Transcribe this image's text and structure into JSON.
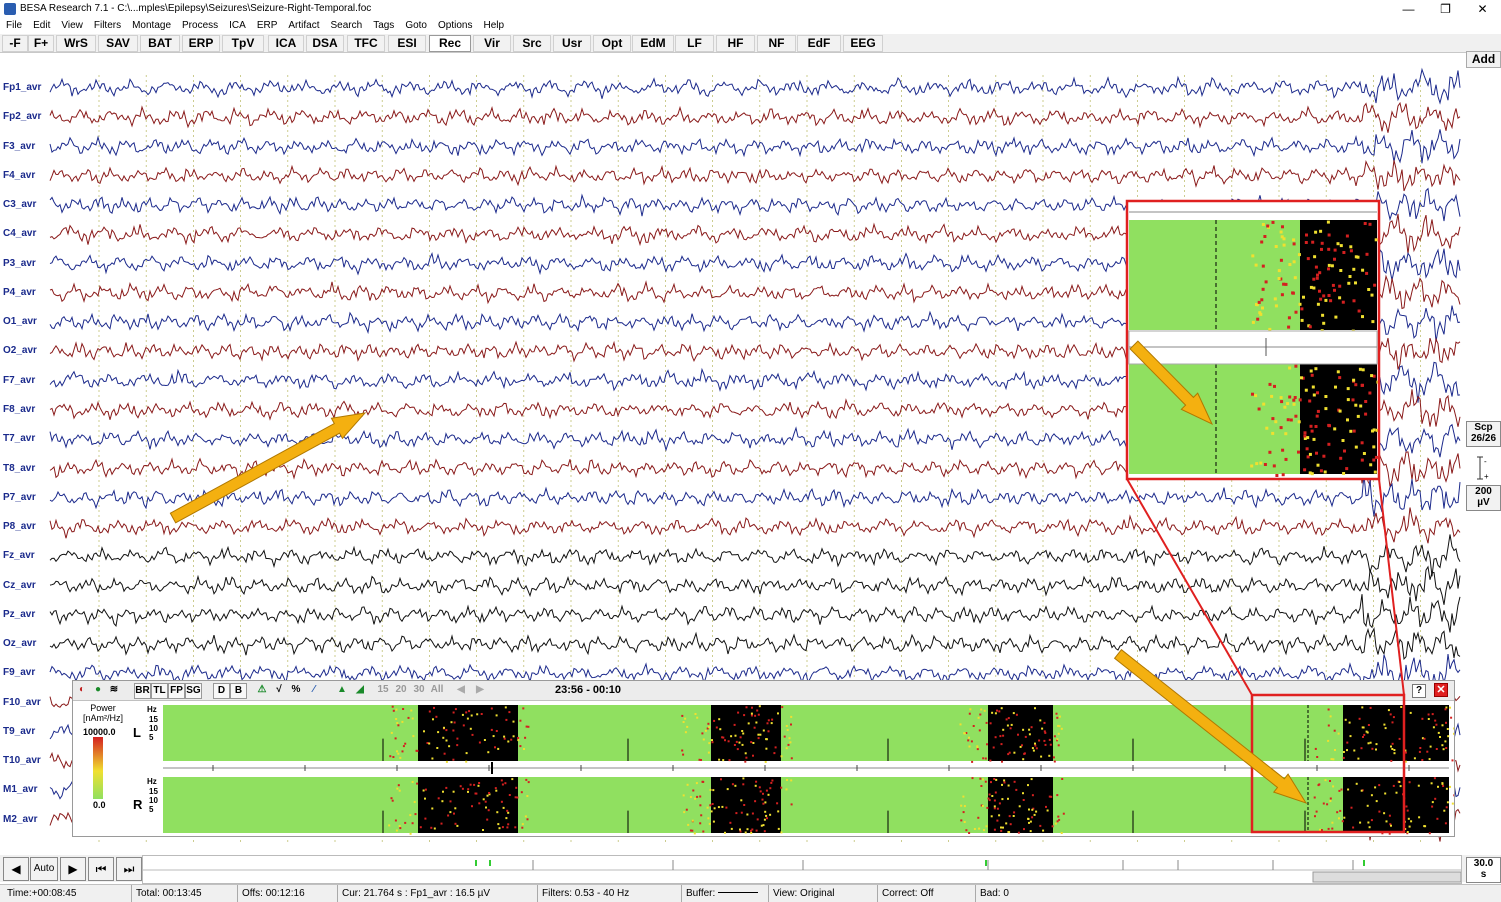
{
  "window": {
    "title": "BESA Research 7.1 - C:\\...mples\\Epilepsy\\Seizures\\Seizure-Right-Temporal.foc",
    "minimize": "—",
    "maximize": "❐",
    "close": "✕"
  },
  "menu": [
    "File",
    "Edit",
    "View",
    "Filters",
    "Montage",
    "Process",
    "ICA",
    "ERP",
    "Artifact",
    "Search",
    "Tags",
    "Goto",
    "Options",
    "Help"
  ],
  "toolbar": {
    "buttons": [
      "-F",
      "F+",
      "WrS",
      "SAV",
      "BAT",
      "ERP",
      "TpV",
      "ICA",
      "DSA",
      "TFC",
      "ESI",
      "Rec",
      "Vir",
      "Src",
      "Usr",
      "Opt",
      "EdM",
      "LF",
      "HF",
      "NF",
      "EdF",
      "EEG"
    ],
    "active": "Rec",
    "add": "Add"
  },
  "channels": [
    {
      "name": "Fp1_avr",
      "color": "#1c2a8c"
    },
    {
      "name": "Fp2_avr",
      "color": "#8a1a1a"
    },
    {
      "name": "F3_avr",
      "color": "#1c2a8c"
    },
    {
      "name": "F4_avr",
      "color": "#8a1a1a"
    },
    {
      "name": "C3_avr",
      "color": "#1c2a8c"
    },
    {
      "name": "C4_avr",
      "color": "#8a1a1a"
    },
    {
      "name": "P3_avr",
      "color": "#1c2a8c"
    },
    {
      "name": "P4_avr",
      "color": "#8a1a1a"
    },
    {
      "name": "O1_avr",
      "color": "#1c2a8c"
    },
    {
      "name": "O2_avr",
      "color": "#8a1a1a"
    },
    {
      "name": "F7_avr",
      "color": "#1c2a8c"
    },
    {
      "name": "F8_avr",
      "color": "#8a1a1a"
    },
    {
      "name": "T7_avr",
      "color": "#1c2a8c"
    },
    {
      "name": "T8_avr",
      "color": "#8a1a1a"
    },
    {
      "name": "P7_avr",
      "color": "#1c2a8c"
    },
    {
      "name": "P8_avr",
      "color": "#8a1a1a"
    },
    {
      "name": "Fz_avr",
      "color": "#111111"
    },
    {
      "name": "Cz_avr",
      "color": "#111111"
    },
    {
      "name": "Pz_avr",
      "color": "#111111"
    },
    {
      "name": "Oz_avr",
      "color": "#111111"
    },
    {
      "name": "F9_avr",
      "color": "#1c2a8c"
    },
    {
      "name": "F10_avr",
      "color": "#8a1a1a"
    },
    {
      "name": "T9_avr",
      "color": "#1c2a8c"
    },
    {
      "name": "T10_avr",
      "color": "#8a1a1a"
    },
    {
      "name": "M1_avr",
      "color": "#1c2a8c"
    },
    {
      "name": "M2_avr",
      "color": "#8a1a1a"
    }
  ],
  "side": {
    "scp_label": "Scp",
    "scp_count": "26/26",
    "scale_value": "200",
    "scale_unit": "µV"
  },
  "tf_panel": {
    "toolbar": [
      "BR",
      "TL",
      "FP",
      "SG",
      "D",
      "B",
      "15",
      "20",
      "30",
      "All"
    ],
    "time_range": "23:56 - 00:10",
    "help": "?",
    "close": "✕",
    "legend_title": "Power [nAm²/Hz]",
    "legend_max": "10000.0",
    "legend_min": "0.0",
    "left_label": "L",
    "right_label": "R",
    "hz_label": "Hz",
    "hz_ticks": [
      "15",
      "10",
      "5"
    ],
    "colors": {
      "low": "#90e060",
      "mid": "#f0e030",
      "high": "#d42020",
      "max": "#000000"
    }
  },
  "nav": {
    "auto": "Auto",
    "timebase": "30.0",
    "timebase_unit": "s",
    "icons": [
      "play-back-icon",
      "play-forward-icon",
      "page-back-icon",
      "page-forward-icon"
    ]
  },
  "status": {
    "time": "Time:+00:08:45",
    "total": "Total: 00:13:45",
    "offs": "Offs: 00:12:16",
    "cur": "Cur: 21.764 s : Fp1_avr : 16.5 µV",
    "filters": "Filters: 0.53 - 40 Hz",
    "buffer": "Buffer:",
    "view": "View: Original",
    "correct": "Correct: Off",
    "bad": "Bad: 0"
  },
  "annotation_colors": {
    "highlight": "#e02020",
    "arrow": "#f4b010"
  }
}
